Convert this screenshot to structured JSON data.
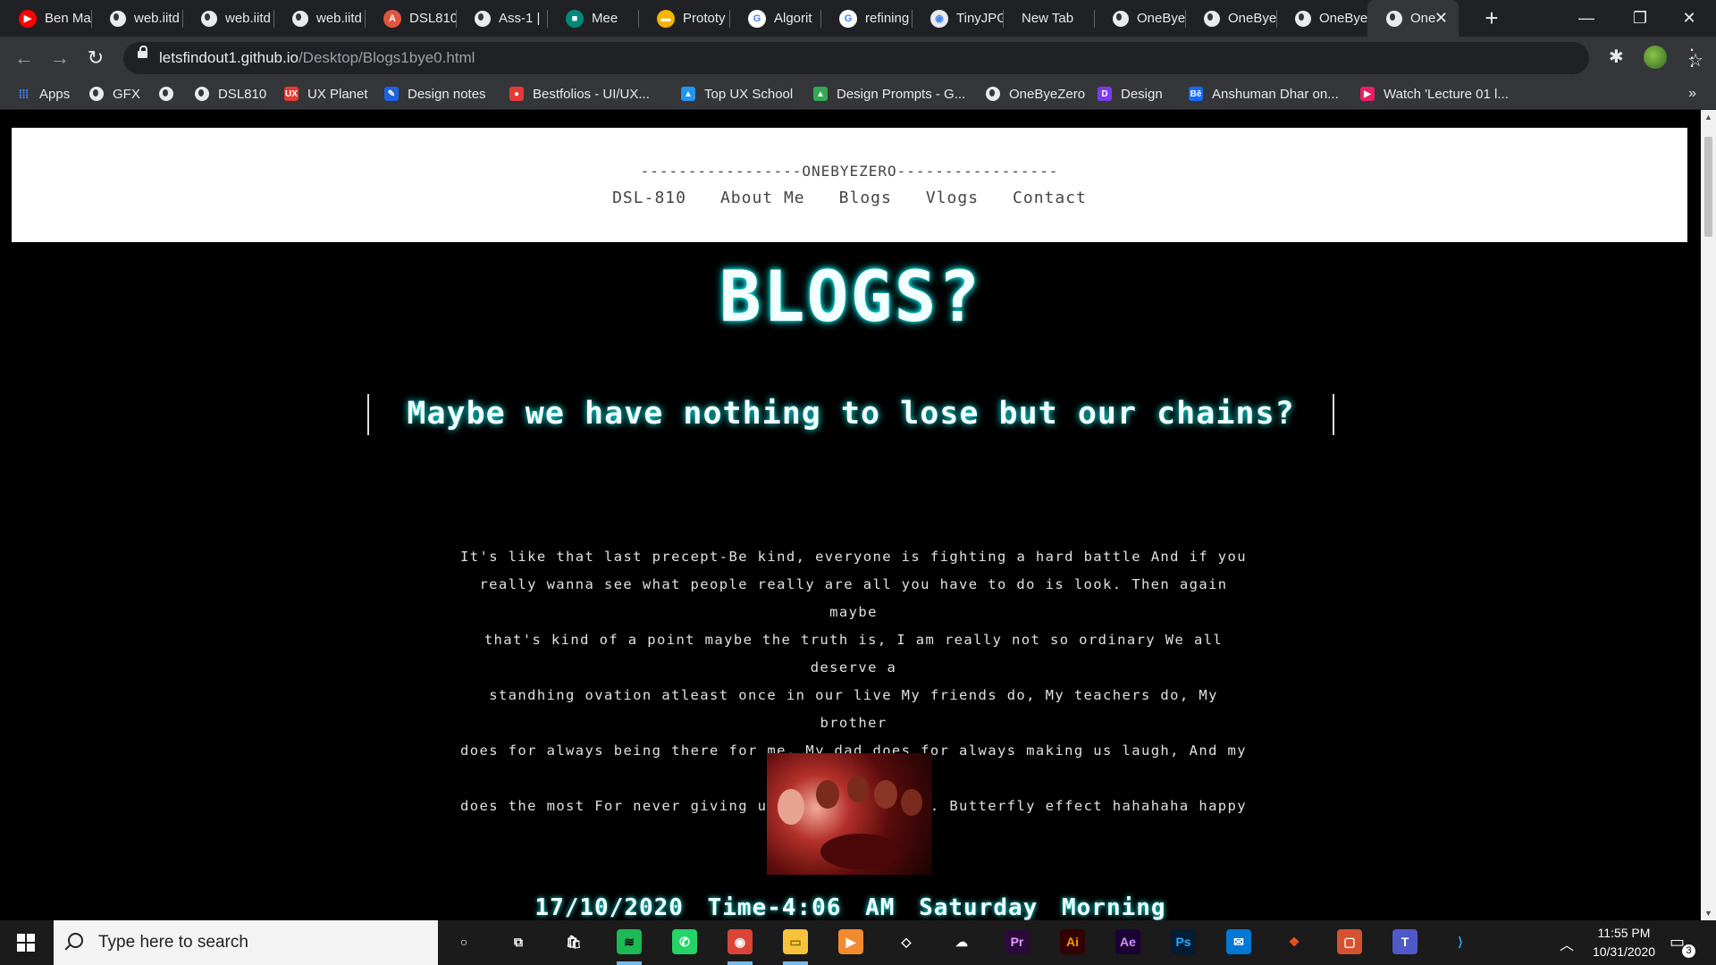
{
  "browser": {
    "tabs": [
      {
        "label": "Ben Ma",
        "icon": "youtube-icon",
        "color": "#ff0000",
        "glyph": "▶"
      },
      {
        "label": "web.iitd",
        "icon": "globe-icon"
      },
      {
        "label": "web.iitd",
        "icon": "globe-icon"
      },
      {
        "label": "web.iitd",
        "icon": "globe-icon"
      },
      {
        "label": "DSL810",
        "icon": "a-icon",
        "color": "#e2553f",
        "glyph": "A"
      },
      {
        "label": "Ass-1 |",
        "icon": "globe-icon"
      },
      {
        "label": "Mee",
        "icon": "meet-icon",
        "color": "#00897b",
        "glyph": "■"
      },
      {
        "label": "Prototy",
        "icon": "slides-icon",
        "color": "#f4b400",
        "glyph": "▬"
      },
      {
        "label": "Algorit",
        "icon": "google-icon",
        "color": "#ffffff",
        "glyph": "G"
      },
      {
        "label": "refining",
        "icon": "google-icon",
        "color": "#ffffff",
        "glyph": "G"
      },
      {
        "label": "TinyJPG",
        "icon": "panda-icon",
        "color": "#e8eaed",
        "glyph": "◉"
      },
      {
        "label": "New Tab",
        "icon": "none"
      },
      {
        "label": "OneBye",
        "icon": "globe-icon"
      },
      {
        "label": "OneBye",
        "icon": "globe-icon"
      },
      {
        "label": "OneBye",
        "icon": "globe-icon"
      },
      {
        "label": "One",
        "icon": "globe-icon",
        "active": true
      }
    ],
    "url_host": "letsfindout1.github.io",
    "url_path": "/Desktop/Blogs1bye0.html",
    "bookmarks": [
      {
        "label": "Apps",
        "icon": "apps-grid-icon"
      },
      {
        "label": "GFX",
        "icon": "globe-icon"
      },
      {
        "label": "",
        "icon": "globe-icon"
      },
      {
        "label": "DSL810",
        "icon": "globe-icon"
      },
      {
        "label": "UX Planet",
        "icon": "ux-icon",
        "color": "#e53935",
        "glyph": "UX"
      },
      {
        "label": "Design notes",
        "icon": "pen-icon",
        "color": "#1e62e0",
        "glyph": "✎"
      },
      {
        "label": "Bestfolios - UI/UX...",
        "icon": "bestfolios-icon",
        "color": "#e53935",
        "glyph": "●"
      },
      {
        "label": "Top UX School",
        "icon": "triangle-icon",
        "color": "#2196f3",
        "glyph": "▲"
      },
      {
        "label": "Design Prompts - G...",
        "icon": "drive-icon",
        "color": "#34a853",
        "glyph": "▲"
      },
      {
        "label": "OneByeZero",
        "icon": "globe-icon"
      },
      {
        "label": "Design",
        "icon": "design-icon",
        "color": "#7c3aed",
        "glyph": "D"
      },
      {
        "label": "Anshuman Dhar on...",
        "icon": "behance-icon",
        "color": "#1769ff",
        "glyph": "Bē"
      },
      {
        "label": "Watch 'Lecture 01 l...",
        "icon": "play-icon",
        "color": "#e91e63",
        "glyph": "▶"
      }
    ]
  },
  "site": {
    "brand": "-----------------ONEBYEZERO-----------------",
    "nav": [
      "DSL-810",
      "About Me",
      "Blogs",
      "Vlogs",
      "Contact"
    ],
    "title": "BLOGS?",
    "quote": "Maybe we have nothing to lose but our chains?",
    "body_lines": [
      "It's like that last precept-Be kind, everyone is fighting a hard battle And if you",
      "really wanna see what people really are all you have to do is look. Then again maybe",
      "that's kind of a point maybe the truth is, I am really not so ordinary We all deserve a",
      "standhing ovation atleast once in our live My friends do, My teachers do, My brother",
      "does for always being there for me, My dad does for always making us laugh, And my mom",
      "does the most For never giving up Specially on me. Butterfly effect hahahaha happy",
      "reading :)"
    ],
    "datetime": "17/10/2020  Time-4:06 AM   Saturday Morning"
  },
  "taskbar": {
    "search_placeholder": "Type here to search",
    "time": "11:55 PM",
    "date": "10/31/2020",
    "notification_count": "3",
    "apps": [
      {
        "icon": "cortana-icon",
        "color": "#1b1b1b",
        "glyph": "○",
        "fg": "#fff"
      },
      {
        "icon": "task-view-icon",
        "color": "#1b1b1b",
        "glyph": "⧉",
        "fg": "#fff"
      },
      {
        "icon": "store-icon",
        "color": "#1b1b1b",
        "glyph": "🛍",
        "fg": "#fff"
      },
      {
        "icon": "spotify-icon",
        "color": "#1db954",
        "glyph": "≋",
        "fg": "#000"
      },
      {
        "icon": "whatsapp-icon",
        "color": "#25d366",
        "glyph": "✆",
        "fg": "#fff"
      },
      {
        "icon": "chrome-icon",
        "color": "#db4437",
        "glyph": "◉",
        "fg": "#fff"
      },
      {
        "icon": "file-explorer-icon",
        "color": "#f9c23c",
        "glyph": "▭",
        "fg": "#8a6d00"
      },
      {
        "icon": "media-player-icon",
        "color": "#f28b30",
        "glyph": "▶",
        "fg": "#fff"
      },
      {
        "icon": "unity-icon",
        "color": "#1b1b1b",
        "glyph": "◇",
        "fg": "#fff"
      },
      {
        "icon": "onedrive-icon",
        "color": "#1b1b1b",
        "glyph": "☁",
        "fg": "#fff"
      },
      {
        "icon": "premiere-icon",
        "color": "#2a0a3a",
        "glyph": "Pr",
        "fg": "#e19bff"
      },
      {
        "icon": "illustrator-icon",
        "color": "#330000",
        "glyph": "Ai",
        "fg": "#ff9a00"
      },
      {
        "icon": "after-effects-icon",
        "color": "#1a0033",
        "glyph": "Ae",
        "fg": "#d291ff"
      },
      {
        "icon": "photoshop-icon",
        "color": "#001d33",
        "glyph": "Ps",
        "fg": "#31a8ff"
      },
      {
        "icon": "mail-icon",
        "color": "#0078d4",
        "glyph": "✉",
        "fg": "#fff"
      },
      {
        "icon": "figma-icon",
        "color": "#1b1b1b",
        "glyph": "❖",
        "fg": "#f24e1e"
      },
      {
        "icon": "powerpoint-icon",
        "color": "#d35230",
        "glyph": "▢",
        "fg": "#fff"
      },
      {
        "icon": "teams-icon",
        "color": "#5059c9",
        "glyph": "T",
        "fg": "#fff"
      },
      {
        "icon": "vscode-icon",
        "color": "#1b1b1b",
        "glyph": "⟩",
        "fg": "#23a9f2"
      }
    ]
  }
}
